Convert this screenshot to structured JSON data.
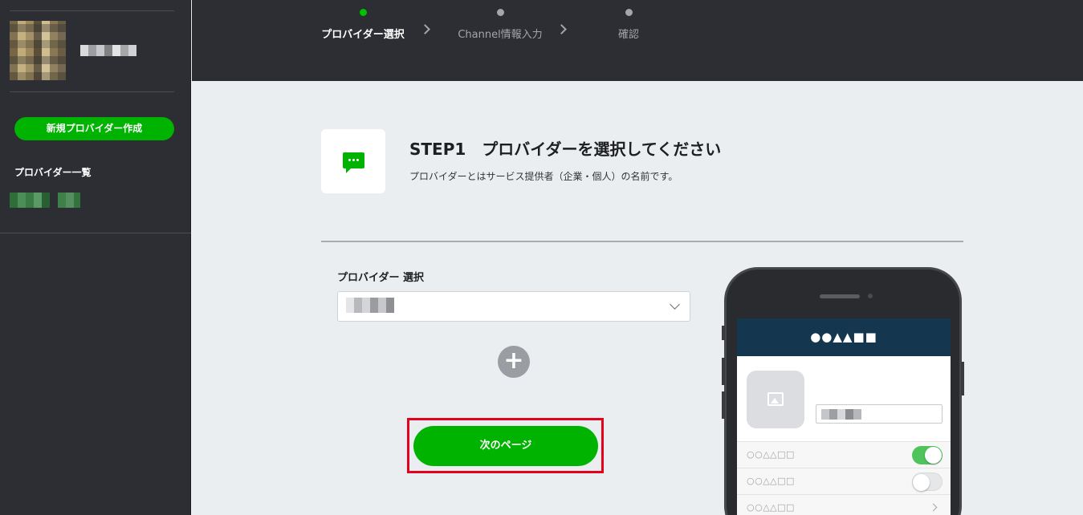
{
  "sidebar": {
    "new_provider_label": "新規プロバイダー作成",
    "provider_list_title": "プロバイダー一覧"
  },
  "steps": [
    {
      "label": "プロバイダー選択",
      "active": true
    },
    {
      "label": "Channel情報入力",
      "active": false
    },
    {
      "label": "確認",
      "active": false
    }
  ],
  "main": {
    "title": "STEP1　プロバイダーを選択してください",
    "description": "プロバイダーとはサービス提供者（企業・個人）の名前です。",
    "select_label": "プロバイダー 選択",
    "add_button_icon": "plus-icon",
    "next_button_label": "次のページ"
  },
  "phone_preview": {
    "header_text": "●●▲▲■■",
    "rows": [
      {
        "label": "○○△△□□",
        "control": "toggle",
        "state": "on"
      },
      {
        "label": "○○△△□□",
        "control": "toggle",
        "state": "off"
      },
      {
        "label": "○○△△□□",
        "control": "chevron"
      }
    ]
  },
  "colors": {
    "accent_green": "#00b300",
    "step_active": "#00c300",
    "highlight_red": "#e5001c",
    "dark_bg": "#2c2e33",
    "phone_header": "#14374f"
  }
}
